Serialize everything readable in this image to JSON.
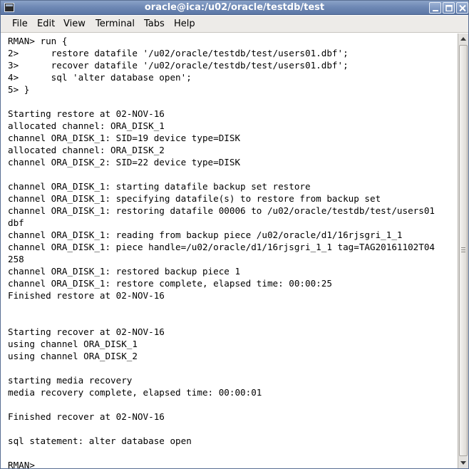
{
  "window": {
    "title": "oracle@ica:/u02/oracle/testdb/test"
  },
  "menu": {
    "file": "File",
    "edit": "Edit",
    "view": "View",
    "terminal": "Terminal",
    "tabs": "Tabs",
    "help": "Help"
  },
  "terminal": {
    "lines": [
      "RMAN> run {",
      "2>      restore datafile '/u02/oracle/testdb/test/users01.dbf';",
      "3>      recover datafile '/u02/oracle/testdb/test/users01.dbf';",
      "4>      sql 'alter database open';",
      "5> }",
      "",
      "Starting restore at 02-NOV-16",
      "allocated channel: ORA_DISK_1",
      "channel ORA_DISK_1: SID=19 device type=DISK",
      "allocated channel: ORA_DISK_2",
      "channel ORA_DISK_2: SID=22 device type=DISK",
      "",
      "channel ORA_DISK_1: starting datafile backup set restore",
      "channel ORA_DISK_1: specifying datafile(s) to restore from backup set",
      "channel ORA_DISK_1: restoring datafile 00006 to /u02/oracle/testdb/test/users01",
      "dbf",
      "channel ORA_DISK_1: reading from backup piece /u02/oracle/d1/16rjsgri_1_1",
      "channel ORA_DISK_1: piece handle=/u02/oracle/d1/16rjsgri_1_1 tag=TAG20161102T04",
      "258",
      "channel ORA_DISK_1: restored backup piece 1",
      "channel ORA_DISK_1: restore complete, elapsed time: 00:00:25",
      "Finished restore at 02-NOV-16",
      "",
      "",
      "Starting recover at 02-NOV-16",
      "using channel ORA_DISK_1",
      "using channel ORA_DISK_2",
      "",
      "starting media recovery",
      "media recovery complete, elapsed time: 00:00:01",
      "",
      "Finished recover at 02-NOV-16",
      "",
      "sql statement: alter database open",
      "",
      "RMAN> "
    ]
  }
}
